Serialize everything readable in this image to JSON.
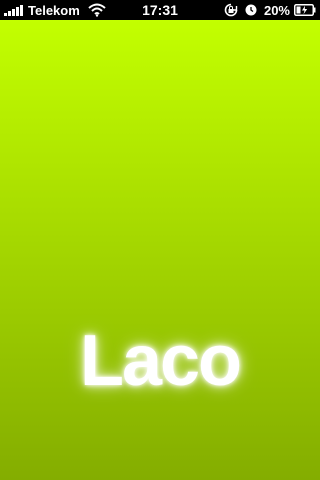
{
  "status_bar": {
    "carrier": "Telekom",
    "time": "17:31",
    "battery_percent": "20%",
    "signal_bars": 5,
    "icons": [
      "signal-icon",
      "wifi-icon",
      "rotation-lock-icon",
      "alarm-icon",
      "battery-charging-icon"
    ]
  },
  "splash": {
    "title": "Laco",
    "colors": {
      "gradient_top": "#c3ff00",
      "gradient_bottom": "#84ad00",
      "title": "#ffffff"
    }
  }
}
